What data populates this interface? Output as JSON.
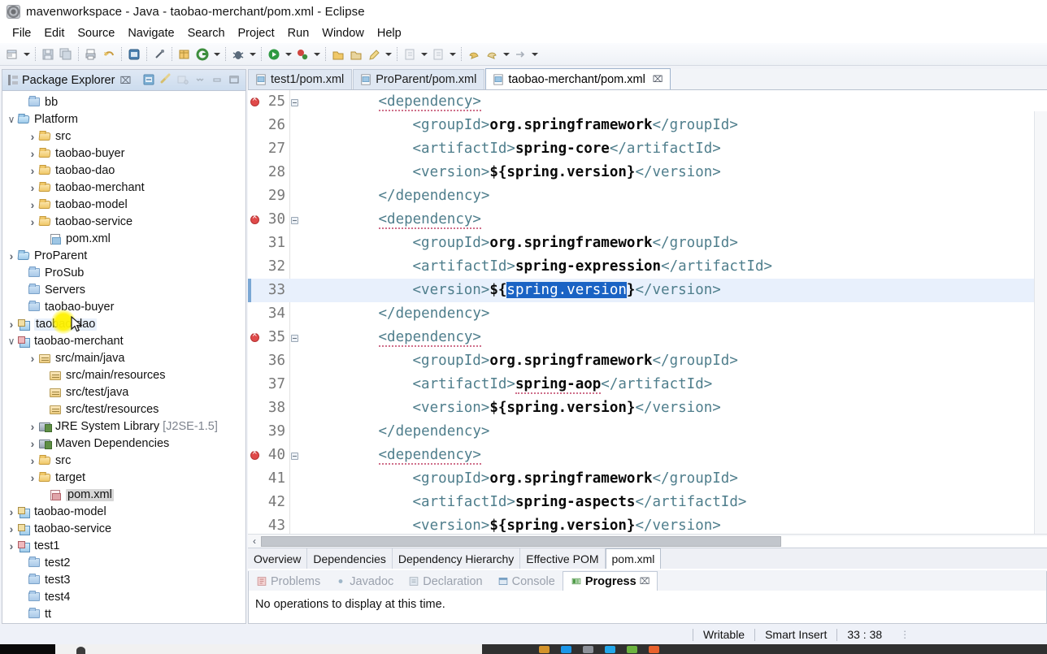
{
  "window": {
    "title": "mavenworkspace - Java - taobao-merchant/pom.xml - Eclipse",
    "app_icon": "eclipse-icon"
  },
  "menubar": {
    "items": [
      "File",
      "Edit",
      "Source",
      "Navigate",
      "Search",
      "Project",
      "Run",
      "Window",
      "Help"
    ]
  },
  "toolbar": {
    "icons": [
      "new-wizard-icon",
      "new-dropdown-arrow",
      "save-icon",
      "save-all-icon",
      "print-icon",
      "undo-icon",
      "open-type-icon",
      "link-icon",
      "new-java-package-icon",
      "git-icon",
      "git-dropdown-arrow",
      "debug-icon",
      "debug-dropdown-arrow",
      "run-icon",
      "run-dropdown-arrow",
      "run-external-tools-icon",
      "run-external-dropdown-arrow",
      "open-perspective-icon",
      "open-resource-icon",
      "search-icon",
      "search-dropdown-arrow",
      "next-annotation-icon",
      "next-annotation-dropdown-arrow",
      "previous-annotation-icon",
      "previous-annotation-dropdown-arrow",
      "back-icon",
      "forward-icon",
      "forward-dropdown-arrow",
      "next-icon",
      "next-dropdown-arrow"
    ]
  },
  "package_explorer": {
    "title": "Package Explorer",
    "close_label": "⌧",
    "tools": [
      "collapse-all-icon",
      "link-with-editor-icon",
      "view-menu-icon",
      "minimize-icon",
      "maximize-icon",
      "restore-icon"
    ],
    "tree": [
      {
        "label": "bb",
        "indent": 1,
        "twist": "none",
        "icon": "folder-plain-icon"
      },
      {
        "label": "Platform",
        "indent": 0,
        "twist": "open",
        "icon": "project-open-icon"
      },
      {
        "label": "src",
        "indent": 2,
        "twist": "closed",
        "icon": "folder-open-icon"
      },
      {
        "label": "taobao-buyer",
        "indent": 2,
        "twist": "closed",
        "icon": "folder-open-icon"
      },
      {
        "label": "taobao-dao",
        "indent": 2,
        "twist": "closed",
        "icon": "folder-open-icon"
      },
      {
        "label": "taobao-merchant",
        "indent": 2,
        "twist": "closed",
        "icon": "folder-open-icon"
      },
      {
        "label": "taobao-model",
        "indent": 2,
        "twist": "closed",
        "icon": "folder-open-icon"
      },
      {
        "label": "taobao-service",
        "indent": 2,
        "twist": "closed",
        "icon": "folder-open-icon"
      },
      {
        "label": "pom.xml",
        "indent": 3,
        "twist": "none",
        "icon": "xml-file-icon"
      },
      {
        "label": "ProParent",
        "indent": 0,
        "twist": "closed",
        "icon": "project-open-icon"
      },
      {
        "label": "ProSub",
        "indent": 1,
        "twist": "none",
        "icon": "folder-plain-icon"
      },
      {
        "label": "Servers",
        "indent": 1,
        "twist": "none",
        "icon": "folder-plain-icon"
      },
      {
        "label": "taobao-buyer",
        "indent": 1,
        "twist": "none",
        "icon": "folder-plain-icon"
      },
      {
        "label": "taobao-dao",
        "indent": 0,
        "twist": "closed",
        "icon": "maven-project-icon",
        "highlight": "blue"
      },
      {
        "label": "taobao-merchant",
        "indent": 0,
        "twist": "open",
        "icon": "maven-project-red-icon"
      },
      {
        "label": "src/main/java",
        "indent": 2,
        "twist": "closed",
        "icon": "source-package-icon"
      },
      {
        "label": "src/main/resources",
        "indent": 3,
        "twist": "none",
        "icon": "source-package-icon"
      },
      {
        "label": "src/test/java",
        "indent": 3,
        "twist": "none",
        "icon": "source-package-icon"
      },
      {
        "label": "src/test/resources",
        "indent": 3,
        "twist": "none",
        "icon": "source-package-icon"
      },
      {
        "label": "JRE System Library",
        "sub": " [J2SE-1.5]",
        "indent": 2,
        "twist": "closed",
        "icon": "library-icon"
      },
      {
        "label": "Maven Dependencies",
        "indent": 2,
        "twist": "closed",
        "icon": "library-icon"
      },
      {
        "label": "src",
        "indent": 2,
        "twist": "closed",
        "icon": "folder-open-icon"
      },
      {
        "label": "target",
        "indent": 2,
        "twist": "closed",
        "icon": "folder-open-icon"
      },
      {
        "label": "pom.xml",
        "indent": 3,
        "twist": "none",
        "icon": "xml-maven-file-icon",
        "highlight": "gray"
      },
      {
        "label": "taobao-model",
        "indent": 0,
        "twist": "closed",
        "icon": "maven-project-icon"
      },
      {
        "label": "taobao-service",
        "indent": 0,
        "twist": "closed",
        "icon": "maven-project-icon"
      },
      {
        "label": "test1",
        "indent": 0,
        "twist": "closed",
        "icon": "maven-project-red-icon"
      },
      {
        "label": "test2",
        "indent": 1,
        "twist": "none",
        "icon": "folder-plain-icon"
      },
      {
        "label": "test3",
        "indent": 1,
        "twist": "none",
        "icon": "folder-plain-icon"
      },
      {
        "label": "test4",
        "indent": 1,
        "twist": "none",
        "icon": "folder-plain-icon"
      },
      {
        "label": "tt",
        "indent": 1,
        "twist": "none",
        "icon": "folder-plain-icon"
      }
    ]
  },
  "editor": {
    "tabs": [
      {
        "label": "test1/pom.xml",
        "active": false,
        "icon": "xml-file-icon",
        "closeable": false
      },
      {
        "label": "ProParent/pom.xml",
        "active": false,
        "icon": "xml-file-icon",
        "closeable": false
      },
      {
        "label": "taobao-merchant/pom.xml",
        "active": true,
        "icon": "xml-file-icon",
        "closeable": true,
        "close_label": "⌧"
      }
    ],
    "lines": [
      {
        "no": "25",
        "error": true,
        "fold": true,
        "indent": 9,
        "segments": [
          {
            "t": "<dependency>",
            "c": "tag",
            "squiggle": true
          }
        ]
      },
      {
        "no": "26",
        "error": false,
        "fold": false,
        "indent": 13,
        "segments": [
          {
            "t": "<groupId>",
            "c": "tag"
          },
          {
            "t": "org.springframework",
            "c": "txt"
          },
          {
            "t": "</groupId>",
            "c": "tag"
          }
        ]
      },
      {
        "no": "27",
        "error": false,
        "fold": false,
        "indent": 13,
        "segments": [
          {
            "t": "<artifactId>",
            "c": "tag"
          },
          {
            "t": "spring-core",
            "c": "txt"
          },
          {
            "t": "</artifactId>",
            "c": "tag"
          }
        ]
      },
      {
        "no": "28",
        "error": false,
        "fold": false,
        "indent": 13,
        "segments": [
          {
            "t": "<version>",
            "c": "tag"
          },
          {
            "t": "${spring.version}",
            "c": "txt"
          },
          {
            "t": "</version>",
            "c": "tag"
          }
        ]
      },
      {
        "no": "29",
        "error": false,
        "fold": false,
        "indent": 9,
        "segments": [
          {
            "t": "</dependency>",
            "c": "tag"
          }
        ]
      },
      {
        "no": "30",
        "error": true,
        "fold": true,
        "indent": 9,
        "segments": [
          {
            "t": "<dependency>",
            "c": "tag",
            "squiggle": true
          }
        ]
      },
      {
        "no": "31",
        "error": false,
        "fold": false,
        "indent": 13,
        "segments": [
          {
            "t": "<groupId>",
            "c": "tag"
          },
          {
            "t": "org.springframework",
            "c": "txt"
          },
          {
            "t": "</groupId>",
            "c": "tag"
          }
        ]
      },
      {
        "no": "32",
        "error": false,
        "fold": false,
        "indent": 13,
        "segments": [
          {
            "t": "<artifactId>",
            "c": "tag"
          },
          {
            "t": "spring-expression",
            "c": "txt"
          },
          {
            "t": "</artifactId>",
            "c": "tag"
          }
        ]
      },
      {
        "no": "33",
        "error": false,
        "fold": false,
        "indent": 13,
        "current": true,
        "segments": [
          {
            "t": "<version>",
            "c": "tag"
          },
          {
            "t": "${",
            "c": "txt"
          },
          {
            "t": "spring.version",
            "c": "sel"
          },
          {
            "t": "}",
            "c": "txt"
          },
          {
            "t": "</version>",
            "c": "tag"
          }
        ]
      },
      {
        "no": "34",
        "error": false,
        "fold": false,
        "indent": 9,
        "segments": [
          {
            "t": "</dependency>",
            "c": "tag"
          }
        ]
      },
      {
        "no": "35",
        "error": true,
        "fold": true,
        "indent": 9,
        "segments": [
          {
            "t": "<dependency>",
            "c": "tag",
            "squiggle": true
          }
        ]
      },
      {
        "no": "36",
        "error": false,
        "fold": false,
        "indent": 13,
        "segments": [
          {
            "t": "<groupId>",
            "c": "tag"
          },
          {
            "t": "org.springframework",
            "c": "txt"
          },
          {
            "t": "</groupId>",
            "c": "tag"
          }
        ]
      },
      {
        "no": "37",
        "error": false,
        "fold": false,
        "indent": 13,
        "segments": [
          {
            "t": "<artifactId>",
            "c": "tag"
          },
          {
            "t": "spring-aop",
            "c": "txt",
            "squiggle": true
          },
          {
            "t": "</artifactId>",
            "c": "tag"
          }
        ]
      },
      {
        "no": "38",
        "error": false,
        "fold": false,
        "indent": 13,
        "segments": [
          {
            "t": "<version>",
            "c": "tag"
          },
          {
            "t": "${spring.version}",
            "c": "txt"
          },
          {
            "t": "</version>",
            "c": "tag"
          }
        ]
      },
      {
        "no": "39",
        "error": false,
        "fold": false,
        "indent": 9,
        "segments": [
          {
            "t": "</dependency>",
            "c": "tag"
          }
        ]
      },
      {
        "no": "40",
        "error": true,
        "fold": true,
        "indent": 9,
        "segments": [
          {
            "t": "<dependency>",
            "c": "tag",
            "squiggle": true
          }
        ]
      },
      {
        "no": "41",
        "error": false,
        "fold": false,
        "indent": 13,
        "segments": [
          {
            "t": "<groupId>",
            "c": "tag"
          },
          {
            "t": "org.springframework",
            "c": "txt"
          },
          {
            "t": "</groupId>",
            "c": "tag"
          }
        ]
      },
      {
        "no": "42",
        "error": false,
        "fold": false,
        "indent": 13,
        "segments": [
          {
            "t": "<artifactId>",
            "c": "tag"
          },
          {
            "t": "spring-aspects",
            "c": "txt"
          },
          {
            "t": "</artifactId>",
            "c": "tag"
          }
        ]
      },
      {
        "no": "43",
        "error": false,
        "fold": false,
        "indent": 13,
        "segments": [
          {
            "t": "<version>",
            "c": "tag"
          },
          {
            "t": "${spring.version}",
            "c": "txt"
          },
          {
            "t": "</version>",
            "c": "tag"
          }
        ]
      }
    ],
    "hscroll_left_label": "‹",
    "form_tabs": [
      {
        "label": "Overview",
        "active": false
      },
      {
        "label": "Dependencies",
        "active": false
      },
      {
        "label": "Dependency Hierarchy",
        "active": false
      },
      {
        "label": "Effective POM",
        "active": false
      },
      {
        "label": "pom.xml",
        "active": true
      }
    ]
  },
  "bottom_panel": {
    "tabs": [
      {
        "label": "Problems",
        "active": false,
        "icon": "problems-icon",
        "closeable": false
      },
      {
        "label": "Javadoc",
        "active": false,
        "icon": "javadoc-icon",
        "closeable": false
      },
      {
        "label": "Declaration",
        "active": false,
        "icon": "declaration-icon",
        "closeable": false
      },
      {
        "label": "Console",
        "active": false,
        "icon": "console-icon",
        "closeable": false
      },
      {
        "label": "Progress",
        "active": true,
        "icon": "progress-icon",
        "closeable": true,
        "close_label": "⌧"
      }
    ],
    "message": "No operations to display at this time."
  },
  "statusbar": {
    "writable": "Writable",
    "insert_mode": "Smart Insert",
    "position": "33 : 38",
    "dots": "⋮"
  },
  "colors": {
    "tag": "#4f7e8c",
    "text": "#0a0a0a",
    "selection_bg": "#1a63c4",
    "selection_fg": "#ffffff",
    "current_line_bg": "#e8f0fc",
    "error_marker": "#e04a4a",
    "tree_selection_bg": "#e8f0fb",
    "accent": "#9fb3cc"
  }
}
